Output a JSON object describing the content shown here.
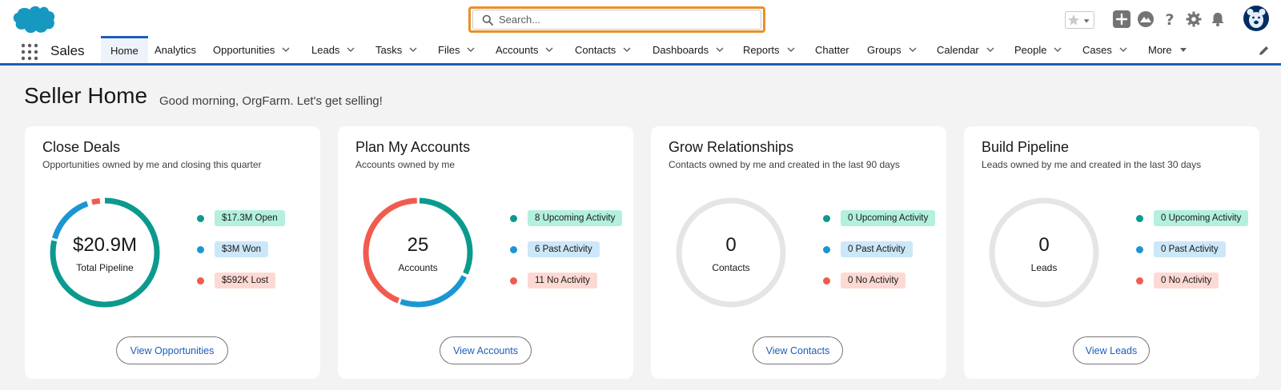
{
  "search": {
    "placeholder": "Search..."
  },
  "app": {
    "name": "Sales"
  },
  "nav": {
    "items": [
      {
        "label": "Home",
        "dropdown": false,
        "active": true
      },
      {
        "label": "Analytics",
        "dropdown": false
      },
      {
        "label": "Opportunities",
        "dropdown": true
      },
      {
        "label": "Leads",
        "dropdown": true
      },
      {
        "label": "Tasks",
        "dropdown": true
      },
      {
        "label": "Files",
        "dropdown": true
      },
      {
        "label": "Accounts",
        "dropdown": true
      },
      {
        "label": "Contacts",
        "dropdown": true
      },
      {
        "label": "Dashboards",
        "dropdown": true
      },
      {
        "label": "Reports",
        "dropdown": true
      },
      {
        "label": "Chatter",
        "dropdown": false
      },
      {
        "label": "Groups",
        "dropdown": true
      },
      {
        "label": "Calendar",
        "dropdown": true
      },
      {
        "label": "People",
        "dropdown": true
      },
      {
        "label": "Cases",
        "dropdown": true
      },
      {
        "label": "More",
        "dropdown": true
      }
    ]
  },
  "header_icons": [
    "favorites-star-icon",
    "favorites-dropdown-icon",
    "global-actions-plus-icon",
    "trailhead-icon",
    "help-icon",
    "setup-gear-icon",
    "notifications-bell-icon",
    "user-avatar"
  ],
  "page": {
    "title": "Seller Home",
    "greeting": "Good morning, OrgFarm. Let's get selling!"
  },
  "cards": [
    {
      "title": "Close Deals",
      "subtitle": "Opportunities owned by me and closing this quarter",
      "value": "$20.9M",
      "value_label": "Total Pipeline",
      "legend": [
        {
          "label": "$17.3M Open",
          "kind": "open"
        },
        {
          "label": "$3M Won",
          "kind": "won"
        },
        {
          "label": "$592K Lost",
          "kind": "lost"
        }
      ],
      "button": "View Opportunities"
    },
    {
      "title": "Plan My Accounts",
      "subtitle": "Accounts owned by me",
      "value": "25",
      "value_label": "Accounts",
      "legend": [
        {
          "label": "8 Upcoming Activity",
          "kind": "open"
        },
        {
          "label": "6 Past Activity",
          "kind": "won"
        },
        {
          "label": "11 No Activity",
          "kind": "lost"
        }
      ],
      "button": "View Accounts"
    },
    {
      "title": "Grow Relationships",
      "subtitle": "Contacts owned by me and created in the last 90 days",
      "value": "0",
      "value_label": "Contacts",
      "legend": [
        {
          "label": "0 Upcoming Activity",
          "kind": "open"
        },
        {
          "label": "0 Past Activity",
          "kind": "won"
        },
        {
          "label": "0 No Activity",
          "kind": "lost"
        }
      ],
      "button": "View Contacts"
    },
    {
      "title": "Build Pipeline",
      "subtitle": "Leads owned by me and created in the last 30 days",
      "value": "0",
      "value_label": "Leads",
      "legend": [
        {
          "label": "0 Upcoming Activity",
          "kind": "open"
        },
        {
          "label": "0 Past Activity",
          "kind": "won"
        },
        {
          "label": "0 No Activity",
          "kind": "lost"
        }
      ],
      "button": "View Leads"
    }
  ],
  "colors": {
    "open": "#0b9a8e",
    "won": "#1b96d3",
    "lost": "#f15b4e",
    "empty": "#e5e5e5",
    "brand_blue": "#1b5fb8",
    "search_highlight": "#e8902a",
    "logo": "#1798c1"
  }
}
